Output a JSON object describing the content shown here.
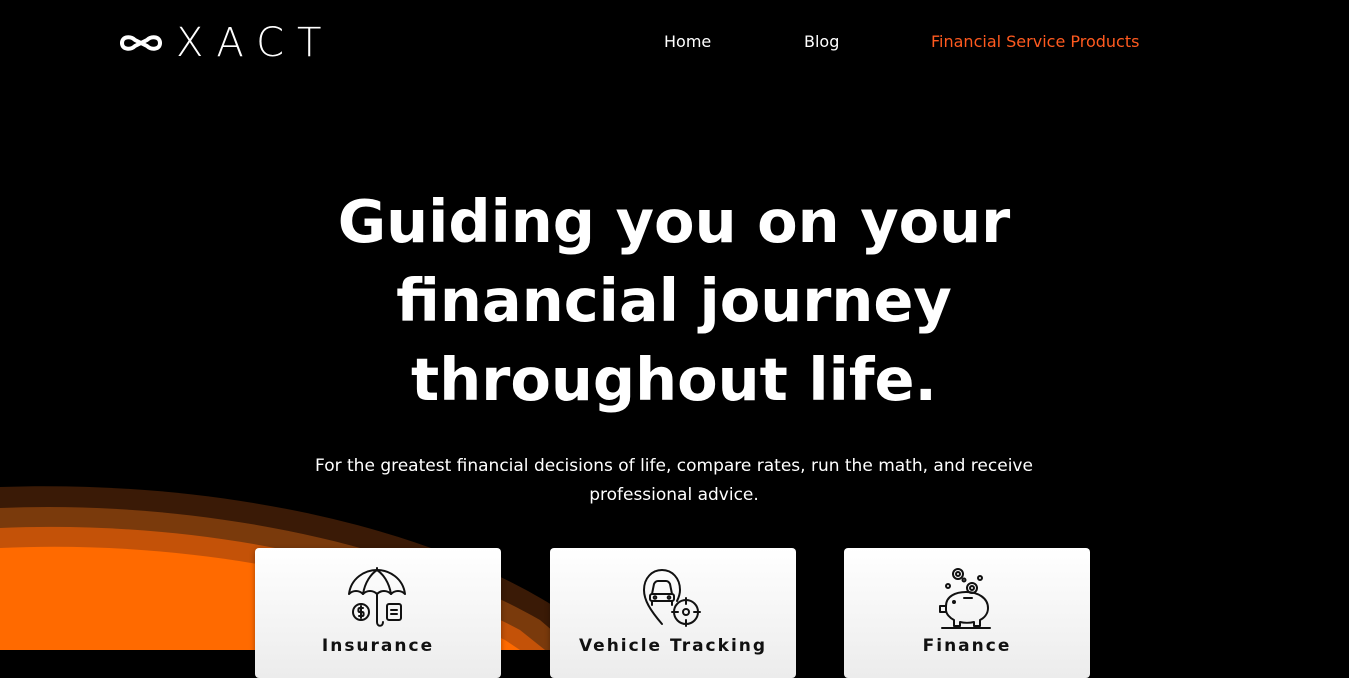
{
  "brand": {
    "logo_text": "XACT"
  },
  "nav": {
    "items": [
      {
        "label": "Home"
      },
      {
        "label": "Blog"
      },
      {
        "label": "Financial Service Products"
      }
    ]
  },
  "hero": {
    "title": "Guiding you on your financial journey throughout life.",
    "subtitle": "For the greatest financial decisions of life, compare rates, run the math, and receive professional advice."
  },
  "cards": [
    {
      "label": "Insurance",
      "icon": "umbrella-money-icon"
    },
    {
      "label": "Vehicle Tracking",
      "icon": "car-location-icon"
    },
    {
      "label": "Finance",
      "icon": "piggy-bank-icon"
    }
  ],
  "colors": {
    "background": "#000000",
    "accent": "#ff5a1f",
    "wave_orange": "#ff6a00",
    "wave_dark": "#5c2806"
  }
}
